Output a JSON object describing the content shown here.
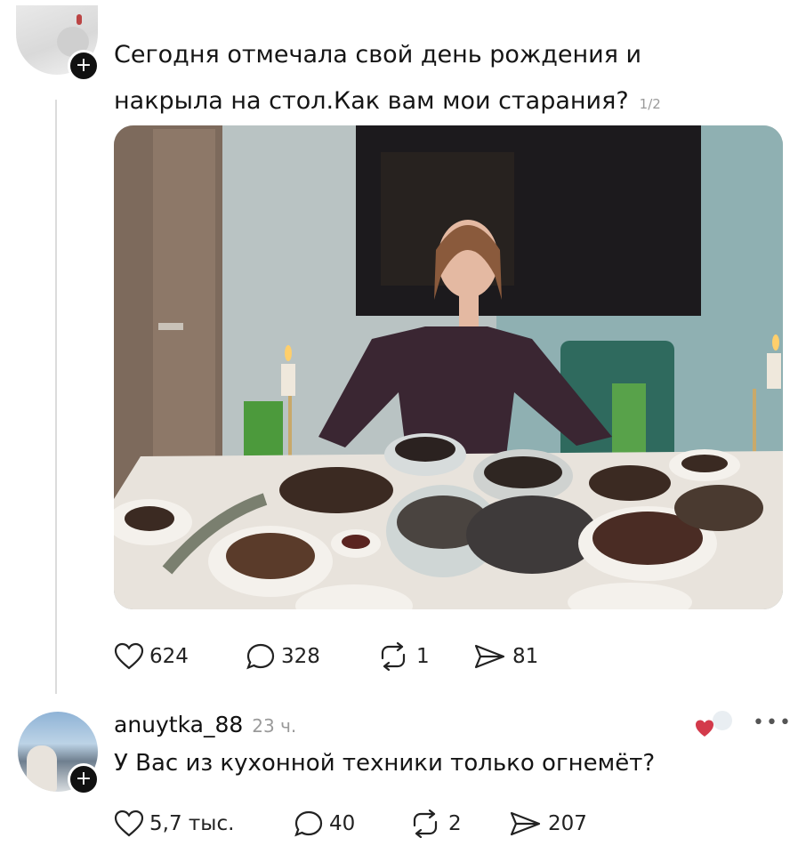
{
  "post": {
    "text": "Сегодня отмечала свой день рождения и накрыла на стол.Как вам мои старания?",
    "image_counter": "1/2",
    "actions": {
      "likes": "624",
      "comments": "328",
      "reposts": "1",
      "shares": "81"
    }
  },
  "comment": {
    "username": "anuytka_88",
    "time": "23 ч.",
    "text": "У Вас из кухонной техники только огнемёт?",
    "actions": {
      "likes": "5,7 тыс.",
      "comments": "40",
      "reposts": "2",
      "shares": "207"
    }
  },
  "icons": {
    "follow": "plus-icon",
    "like": "heart-icon",
    "comment": "comment-bubble-icon",
    "repost": "repost-icon",
    "share": "send-icon",
    "more": "more-dots-icon"
  },
  "colors": {
    "text": "#151515",
    "muted": "#9a9a9a",
    "like_red": "#d33a4b"
  }
}
